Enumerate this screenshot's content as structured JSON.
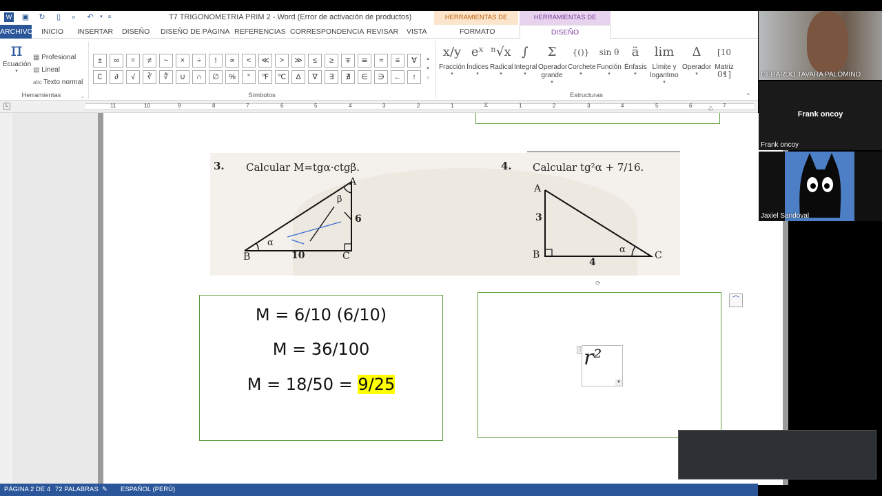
{
  "window": {
    "title": "T7 TRIGONOMETRIA PRIM 2 - Word (Error de activación de productos)"
  },
  "context_headers": {
    "dibujo": "HERRAMIENTAS DE DIBUJO",
    "ecuacion": "HERRAMIENTAS DE ECUACIÓN"
  },
  "tabs": [
    "ARCHIVO",
    "INICIO",
    "INSERTAR",
    "DISEÑO",
    "DISEÑO DE PÁGINA",
    "REFERENCIAS",
    "CORRESPONDENCIA",
    "REVISAR",
    "VISTA",
    "FORMATO",
    "DISEÑO"
  ],
  "ribbon": {
    "herramientas": {
      "ecuacion": "Ecuación",
      "profesional": "Profesional",
      "lineal": "Lineal",
      "texto_normal": "Texto normal",
      "group": "Herramientas"
    },
    "simbolos": {
      "row1": [
        "±",
        "∞",
        "=",
        "≠",
        "~",
        "×",
        "÷",
        "!",
        "∝",
        "<",
        "≪",
        ">",
        "≫",
        "≤",
        "≥",
        "∓",
        "≅",
        "≈",
        "≡",
        "∀"
      ],
      "row2": [
        "∁",
        "∂",
        "√",
        "∛",
        "∜",
        "∪",
        "∩",
        "∅",
        "%",
        "°",
        "℉",
        "℃",
        "∆",
        "∇",
        "∃",
        "∄",
        "∈",
        "∋",
        "←",
        "↑"
      ],
      "group": "Símbolos"
    },
    "estructuras": {
      "items": [
        {
          "glyph": "x/y",
          "label": "Fracción"
        },
        {
          "glyph": "eˣ",
          "label": "Índices"
        },
        {
          "glyph": "ⁿ√x",
          "label": "Radical"
        },
        {
          "glyph": "∫",
          "label": "Integral"
        },
        {
          "glyph": "Σ",
          "label": "Operador grande"
        },
        {
          "glyph": "{()}",
          "label": "Corchete"
        },
        {
          "glyph": "sin θ",
          "label": "Función"
        },
        {
          "glyph": "ä",
          "label": "Énfasis"
        },
        {
          "glyph": "lim",
          "label": "Límite y logaritmo"
        },
        {
          "glyph": "Δ",
          "label": "Operador"
        },
        {
          "glyph": "[10 01]",
          "label": "Matriz"
        }
      ],
      "group": "Estructuras"
    }
  },
  "ruler_numbers": [
    "11",
    "10",
    "9",
    "8",
    "7",
    "6",
    "5",
    "4",
    "3",
    "2",
    "1",
    "1",
    "2",
    "3",
    "4",
    "5",
    "6",
    "7"
  ],
  "document": {
    "problem3": {
      "number": "3.",
      "text": "Calcular  M=tgα·ctgβ.",
      "labels": {
        "A": "A",
        "B": "B",
        "C": "C",
        "alpha": "α",
        "beta": "β",
        "side_bc": "10",
        "side_ac": "6"
      }
    },
    "problem4": {
      "number": "4.",
      "text": "Calcular  tg²α + 7/16.",
      "labels": {
        "A": "A",
        "B": "B",
        "C": "C",
        "alpha": "α",
        "side_ab": "3",
        "side_bc": "4"
      }
    },
    "box1": {
      "line1": "M = 6/10 (6/10)",
      "line2": "M = 36/100",
      "line3_prefix": "M = 18/50 = ",
      "line3_highlight": "9/25"
    },
    "box2": {
      "equation": "r²"
    }
  },
  "status": {
    "page": "PÁGINA 2 DE 4",
    "words": "72 PALABRAS",
    "language": "ESPAÑOL (PERÚ)"
  },
  "participants": [
    {
      "name": "GERARDO TAVARA PALOMINO"
    },
    {
      "name": "Frank oncoy",
      "display": "Frank oncoy"
    },
    {
      "name": "Jaxiel Sandoval"
    }
  ],
  "colors": {
    "accent": "#2b579a",
    "box_border": "#5b9b3a",
    "highlight": "#ffff00",
    "ctx_dibujo": "#fbe5cc",
    "ctx_ecuacion": "#e8d3ef"
  }
}
